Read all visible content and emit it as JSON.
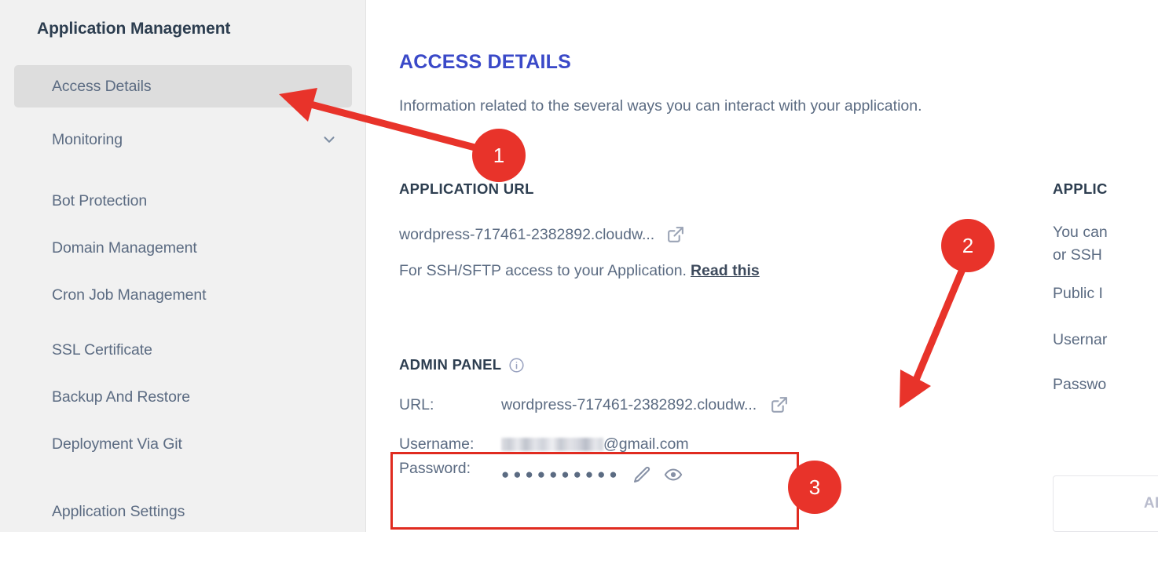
{
  "sidebar": {
    "title": "Application Management",
    "items": [
      {
        "label": "Access Details",
        "active": true,
        "chevron": false
      },
      {
        "label": "Monitoring",
        "active": false,
        "chevron": true
      },
      {
        "label": "Bot Protection",
        "active": false,
        "chevron": false
      },
      {
        "label": "Domain Management",
        "active": false,
        "chevron": false
      },
      {
        "label": "Cron Job Management",
        "active": false,
        "chevron": false
      },
      {
        "label": "SSL Certificate",
        "active": false,
        "chevron": false
      },
      {
        "label": "Backup And Restore",
        "active": false,
        "chevron": false
      },
      {
        "label": "Deployment Via Git",
        "active": false,
        "chevron": false
      },
      {
        "label": "Application Settings",
        "active": false,
        "chevron": false
      }
    ]
  },
  "main": {
    "heading": "ACCESS DETAILS",
    "subheading": "Information related to the several ways you can interact with your application.",
    "application_url": {
      "label": "APPLICATION URL",
      "url": "wordpress-717461-2382892.cloudw...",
      "ssh_note": "For SSH/SFTP access to your Application.",
      "read_link": "Read this"
    },
    "admin_panel": {
      "label": "ADMIN PANEL",
      "url_key": "URL:",
      "url_value": "wordpress-717461-2382892.cloudw...",
      "username_key": "Username:",
      "username_value": "@gmail.com",
      "password_key": "Password:",
      "password_masked": "●●●●●●●●●●"
    },
    "application_credentials": {
      "label": "APPLIC",
      "line1": "You can",
      "line2": "or SSH",
      "public_ip": "Public I",
      "username": "Usernar",
      "password": "Passwo",
      "button": "AD"
    }
  },
  "annotations": {
    "badges": [
      "1",
      "2",
      "3"
    ],
    "accent_color": "#e8332a"
  },
  "icons": {
    "external_link": "external-link-icon",
    "info": "info-icon",
    "pencil": "pencil-icon",
    "eye": "eye-icon",
    "chevron_down": "chevron-down-icon"
  }
}
